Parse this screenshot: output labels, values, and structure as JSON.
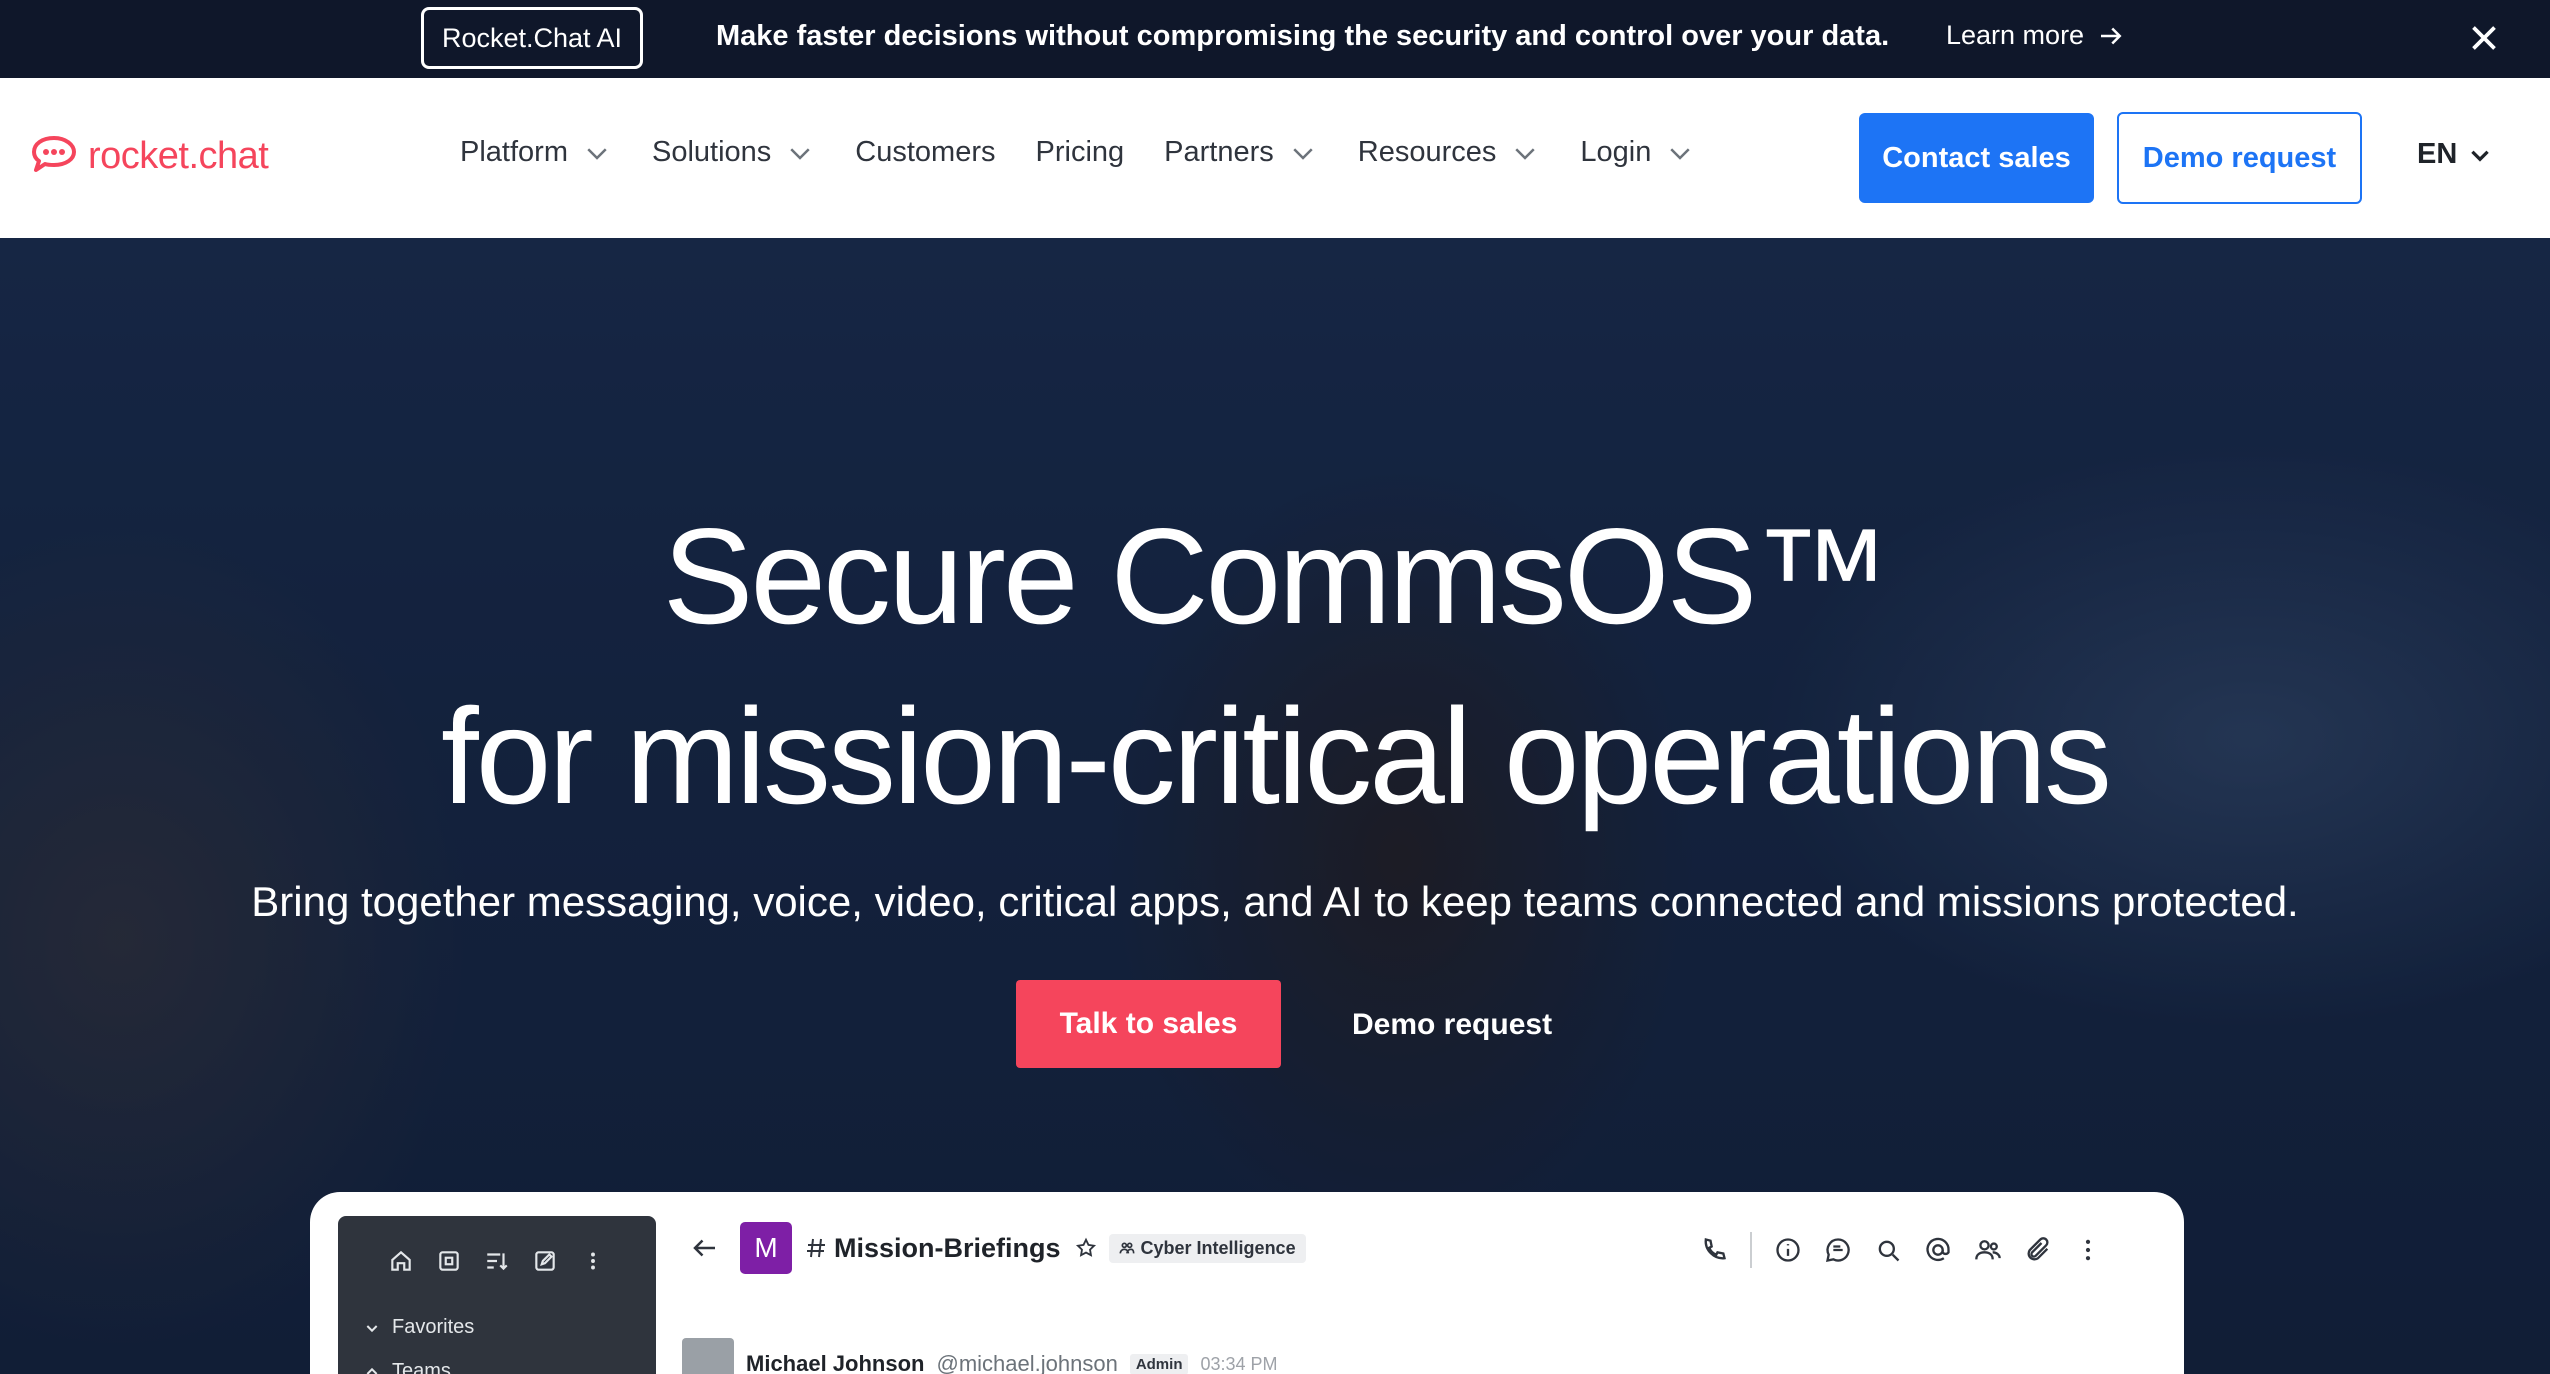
{
  "announcement": {
    "badge": "Rocket.Chat AI",
    "text": "Make faster decisions without compromising the security and control over your data.",
    "link": "Learn more"
  },
  "nav": {
    "logo_text": "rocket.chat",
    "menu": [
      {
        "label": "Platform",
        "dropdown": true
      },
      {
        "label": "Solutions",
        "dropdown": true
      },
      {
        "label": "Customers",
        "dropdown": false
      },
      {
        "label": "Pricing",
        "dropdown": false
      },
      {
        "label": "Partners",
        "dropdown": true
      },
      {
        "label": "Resources",
        "dropdown": true
      },
      {
        "label": "Login",
        "dropdown": true
      }
    ],
    "contact_label": "Contact sales",
    "demo_label": "Demo request",
    "lang": "EN"
  },
  "hero": {
    "title_line1": "Secure CommsOS™",
    "title_line2": "for mission-critical operations",
    "subtitle": "Bring together messaging, voice, video, critical apps, and AI to keep teams connected and missions protected.",
    "primary_cta": "Talk to sales",
    "secondary_cta": "Demo request"
  },
  "preview": {
    "sidebar": {
      "favorites": "Favorites",
      "teams": "Teams"
    },
    "channel": {
      "avatar_letter": "M",
      "name": "Mission-Briefings",
      "tag": "Cyber Intelligence"
    },
    "message": {
      "author": "Michael Johnson",
      "handle": "@michael.johnson",
      "role": "Admin",
      "time": "03:34 PM"
    }
  },
  "colors": {
    "brand_red": "#f5455c",
    "brand_blue": "#1d74f5",
    "announce_bg": "#0f172a"
  }
}
